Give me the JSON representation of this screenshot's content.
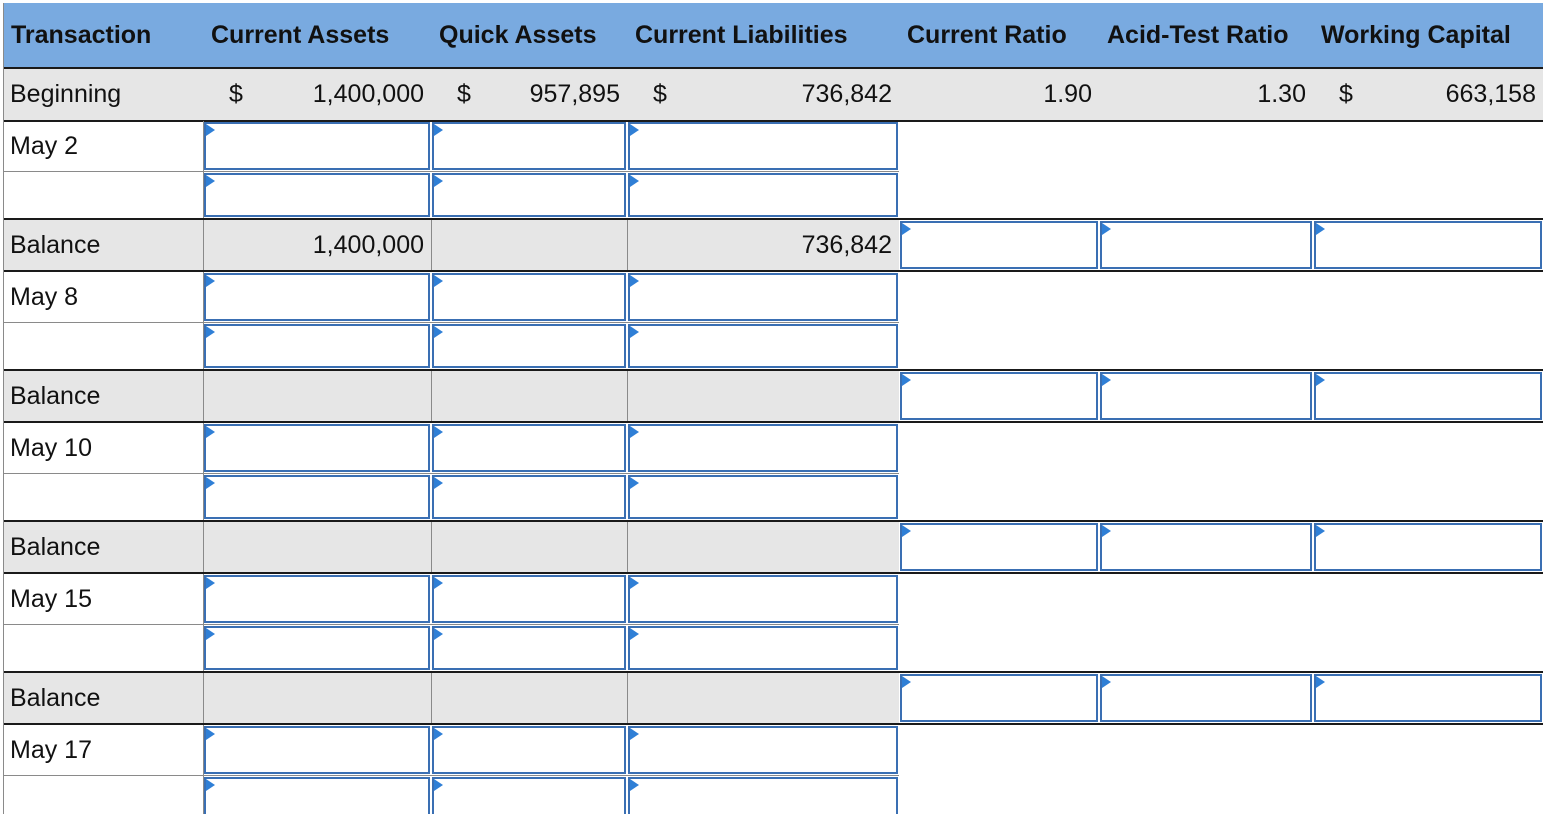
{
  "table": {
    "headers": [
      "Transaction",
      "Current Assets",
      "Quick Assets",
      "Current Liabilities",
      "Current Ratio",
      "Acid-Test Ratio",
      "Working Capital"
    ],
    "currency_symbol": "$",
    "beginning": {
      "label": "Beginning",
      "current_assets": "1,400,000",
      "quick_assets": "957,895",
      "current_liabilities": "736,842",
      "current_ratio": "1.90",
      "acid_test_ratio": "1.30",
      "working_capital": "663,158"
    },
    "transactions": [
      {
        "label": "May 2",
        "balance_label": "Balance",
        "balance_current_assets": "1,400,000",
        "balance_current_liabilities": "736,842"
      },
      {
        "label": "May 8",
        "balance_label": "Balance"
      },
      {
        "label": "May 10",
        "balance_label": "Balance"
      },
      {
        "label": "May 15",
        "balance_label": "Balance"
      },
      {
        "label": "May 17"
      }
    ]
  },
  "colors": {
    "header_bg": "#79aae0",
    "balance_row_bg": "#e6e6e6",
    "input_border": "#3a6fb3",
    "input_marker": "#2f7fd6"
  }
}
